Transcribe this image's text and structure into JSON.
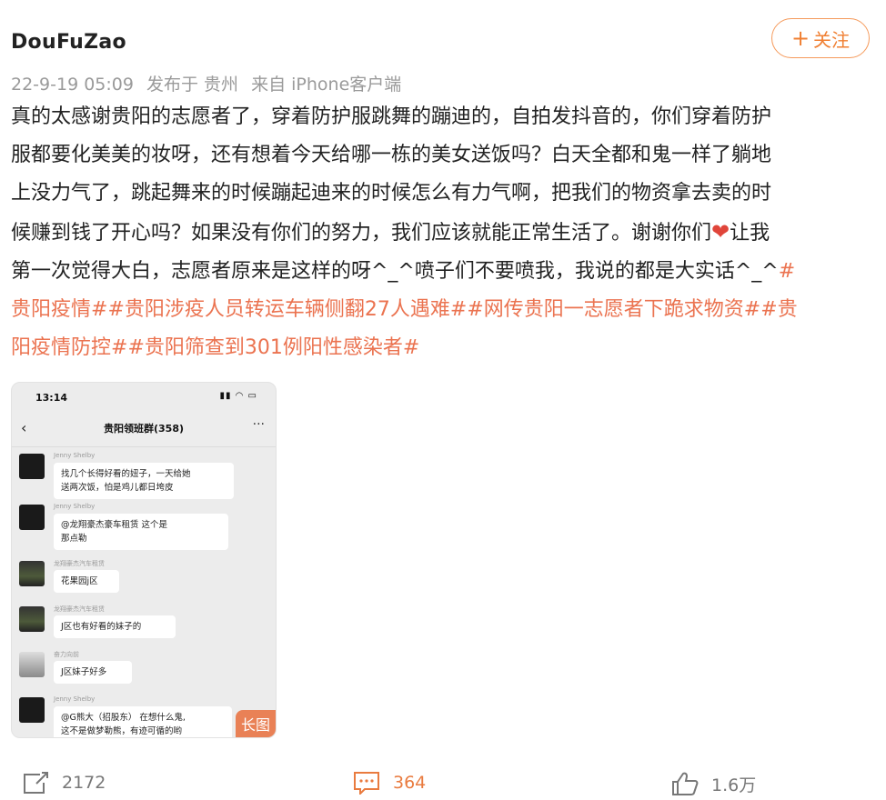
{
  "user": {
    "name": "DouFuZao",
    "follow_label": "关注"
  },
  "meta": {
    "time": "22-9-19 05:09",
    "location": "发布于 贵州",
    "source": "来自 iPhone客户端"
  },
  "post": {
    "text_line1": "真的太感谢贵阳的志愿者了，穿着防护服跳舞的蹦迪的，自拍发抖音的，你们穿着防护",
    "text_line2": "服都要化美美的妆呀，还有想着今天给哪一栋的美女送饭吗？白天全都和鬼一样了躺地",
    "text_line3": "上没力气了，跳起舞来的时候蹦起迪来的时候怎么有力气啊，把我们的物资拿去卖的时",
    "text_line4a": "候赚到钱了开心吗？如果没有你们的努力，我们应该就能正常生活了。谢谢你们",
    "text_line4b": "让我",
    "text_line5a": "第一次觉得大白，志愿者原来是这样的呀^_^喷子们不要喷我，我说的都是大实话^_^",
    "tag1": "#贵阳疫情#",
    "tag2": "#贵阳涉疫人员转运车辆侧翻27人遇难#",
    "tag3": "#网传贵阳一志愿者下跪求物资#",
    "tag4": "#贵阳疫情防控#",
    "tag5": "#贵阳筛查到301例阳性感染者#",
    "tag1_part1": "#",
    "tag1_part2": "贵阳疫情#",
    "tag4_part1": "#贵",
    "tag4_part2": "阳疫情防控#"
  },
  "screenshot": {
    "time": "13:14",
    "chat_title": "贵阳领班群(358)",
    "long_image_label": "长图",
    "messages": [
      {
        "sender": "Jenny Shelby",
        "text1": "找几个长得好看的妞子，一天给她",
        "text2": "送两次饭，怕是鸡儿都日垮皮"
      },
      {
        "sender": "Jenny Shelby",
        "text1": "@龙翔豪杰豪车租赁 这个是",
        "text2": "那点勒"
      },
      {
        "sender": "龙翔豪杰汽车租赁",
        "text1": "花果园j区",
        "text2": ""
      },
      {
        "sender": "龙翔豪杰汽车租赁",
        "text1": "J区也有好看的妹子的",
        "text2": ""
      },
      {
        "sender": "奋力向前",
        "text1": "J区妹子好多",
        "text2": ""
      },
      {
        "sender": "Jenny Shelby",
        "text1": "@G熊大（招股东） 在想什么鬼,",
        "text2": "这不是做梦勒熊，有迹可循的哟"
      }
    ]
  },
  "actions": {
    "share_count": "2172",
    "comment_count": "364",
    "like_count": "1.6万"
  },
  "colors": {
    "accent": "#eb7350",
    "follow": "#f07f32",
    "meta": "#9a9a9a"
  }
}
